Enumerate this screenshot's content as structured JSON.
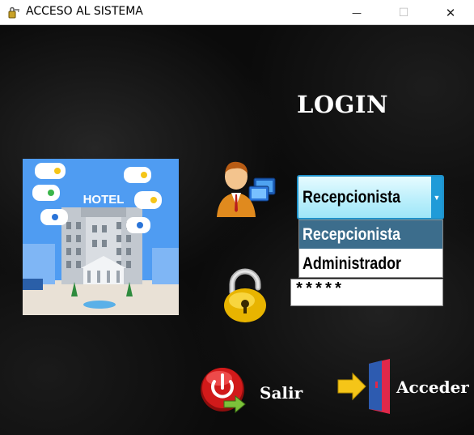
{
  "window": {
    "title": "ACCESO AL SISTEMA",
    "minimize_glyph": "—",
    "maximize_glyph": "☐",
    "close_glyph": "✕"
  },
  "login": {
    "title": "LOGIN"
  },
  "hotel_image": {
    "sign": "HOTEL"
  },
  "user_role": {
    "selected": "Recepcionista",
    "arrow_glyph": "▼",
    "options": [
      "Recepcionista",
      "Administrador"
    ]
  },
  "password": {
    "value": "*****"
  },
  "buttons": {
    "exit_label": "Salir",
    "access_label": "Acceder"
  },
  "colors": {
    "background": "#0b0b0b",
    "combo_border": "#1e90c8",
    "combo_fill": "#b8eefb",
    "selected_option_bg": "#3c6d8c",
    "exit_red": "#d11a1a",
    "arrow_yellow": "#f5c518",
    "door_red": "#e0284a",
    "door_blue": "#2d5bb0"
  },
  "icons": {
    "app": "key-lock-icon",
    "user": "user-computer-icon",
    "lock": "padlock-icon",
    "exit": "power-exit-icon",
    "access": "door-enter-icon"
  }
}
